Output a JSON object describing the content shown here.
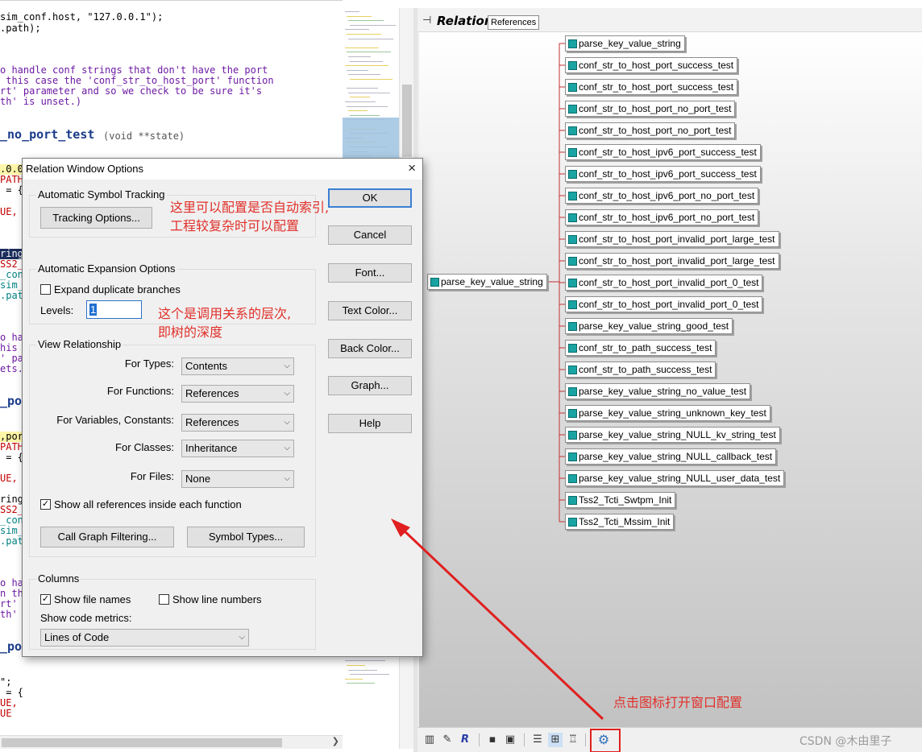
{
  "editor": {
    "lines": [
      "sim_conf.host, \"127.0.0.1\");",
      ".path);",
      "o handle conf strings that don't have the port",
      " this case the 'conf_str_to_host_port' function",
      "rt' parameter and so we check to be sure it's",
      "th' is unset.)",
      "_no_port_test",
      "(void **state)",
      ".0.0",
      "PATH",
      " = {",
      "UE,",
      "ring",
      "SS2_",
      "_con",
      "sim_",
      ".pat",
      "o ha",
      "his",
      "' pa",
      "ets.",
      "_po",
      ",por",
      "PATH",
      " = {",
      "UE,",
      "ring",
      "SS2_",
      "_con",
      "sim_",
      ".pat",
      "o ha",
      "n th",
      "rt'",
      "th'",
      "_po",
      "\";",
      " = {",
      "UE,",
      "UE"
    ]
  },
  "relation": {
    "title": "Relation",
    "mode": "References",
    "root": "parse_key_value_string",
    "top_node": "parse_key_value_string",
    "children": [
      "conf_str_to_host_port_success_test",
      "conf_str_to_host_port_success_test",
      "conf_str_to_host_port_no_port_test",
      "conf_str_to_host_port_no_port_test",
      "conf_str_to_host_ipv6_port_success_test",
      "conf_str_to_host_ipv6_port_success_test",
      "conf_str_to_host_ipv6_port_no_port_test",
      "conf_str_to_host_ipv6_port_no_port_test",
      "conf_str_to_host_port_invalid_port_large_test",
      "conf_str_to_host_port_invalid_port_large_test",
      "conf_str_to_host_port_invalid_port_0_test",
      "conf_str_to_host_port_invalid_port_0_test",
      "parse_key_value_string_good_test",
      "conf_str_to_path_success_test",
      "conf_str_to_path_success_test",
      "parse_key_value_string_no_value_test",
      "parse_key_value_string_unknown_key_test",
      "parse_key_value_string_NULL_kv_string_test",
      "parse_key_value_string_NULL_callback_test",
      "parse_key_value_string_NULL_user_data_test",
      "Tss2_Tcti_Swtpm_Init",
      "Tss2_Tcti_Mssim_Init"
    ],
    "toolbar_icons": [
      "lock-file-icon",
      "reference-icon",
      "relation-icon",
      "lock-icon",
      "save-icon",
      "outline-icon",
      "tree-layout-icon",
      "hierarchy-icon",
      "gear-icon"
    ]
  },
  "dialog": {
    "title": "Relation Window Options",
    "close": "×",
    "auto_tracking": {
      "label": "Automatic Symbol Tracking",
      "button": "Tracking Options..."
    },
    "auto_expansion": {
      "label": "Automatic Expansion Options",
      "expand_duplicates": "Expand duplicate branches",
      "levels_label": "Levels:",
      "levels_value": "1"
    },
    "view_relationship": {
      "label": "View Relationship",
      "rows": [
        {
          "label": "For Types:",
          "value": "Contents"
        },
        {
          "label": "For Functions:",
          "value": "References"
        },
        {
          "label": "For Variables, Constants:",
          "value": "References"
        },
        {
          "label": "For Classes:",
          "value": "Inheritance"
        },
        {
          "label": "For Files:",
          "value": "None"
        }
      ],
      "show_all_refs": "Show all references inside each function",
      "call_graph_button": "Call Graph Filtering...",
      "symbol_types_button": "Symbol Types..."
    },
    "columns": {
      "label": "Columns",
      "show_file_names": "Show file names",
      "show_line_numbers": "Show line numbers",
      "metrics_label": "Show code metrics:",
      "metrics_value": "Lines of Code"
    },
    "buttons": {
      "ok": "OK",
      "cancel": "Cancel",
      "font": "Font...",
      "text_color": "Text Color...",
      "back_color": "Back Color...",
      "graph": "Graph...",
      "help": "Help"
    }
  },
  "annotations": {
    "tracking_note_1": "这里可以配置是否自动索引,",
    "tracking_note_2": "工程较复杂时可以配置",
    "levels_note_1": "这个是调用关系的层次,",
    "levels_note_2": "即树的深度",
    "gear_note": "点击图标打开窗口配置"
  },
  "watermark": "CSDN @木由里子",
  "colors": {
    "annotation": "#e0302a",
    "highlight_box": "#e02020",
    "default_button_border": "#3c7fd4"
  }
}
